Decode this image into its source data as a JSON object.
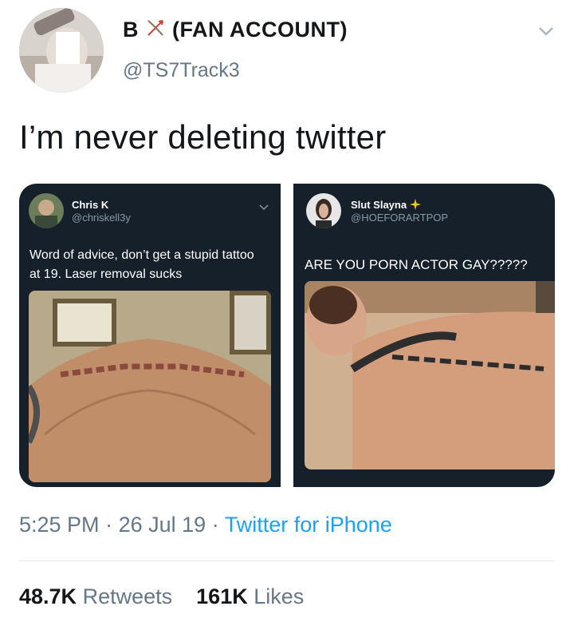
{
  "tweet": {
    "display_name": "B",
    "display_name_suffix": "(FAN ACCOUNT)",
    "handle": "@TS7Track3",
    "text": "I’m never deleting twitter",
    "time": "5:25 PM",
    "separator": "·",
    "date": "26 Jul 19",
    "source": "Twitter for iPhone",
    "retweets_count": "48.7K",
    "retweets_label": "Retweets",
    "likes_count": "161K",
    "likes_label": "Likes"
  },
  "embedded": [
    {
      "name": "Chris K",
      "handle": "@chriskell3y",
      "text_line1": "Word of advice, don’t get a stupid tattoo",
      "text_line2": "at 19. Laser removal sucks"
    },
    {
      "name": "Slut Slayna",
      "handle": "@HOEFORARTPOP",
      "text": "ARE YOU PORN ACTOR GAY?????"
    }
  ],
  "icons": {
    "name_emoji": "bow-and-arrow-icon",
    "caret": "chevron-down-icon",
    "sparkles": "sparkles-icon"
  },
  "colors": {
    "link": "#1da1f2",
    "secondary_text": "#657786",
    "dark_card": "#15202b"
  }
}
